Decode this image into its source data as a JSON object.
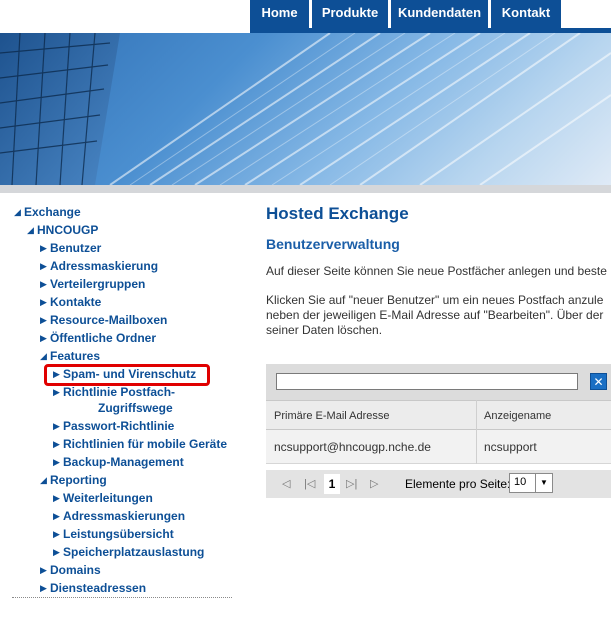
{
  "nav": {
    "items": [
      {
        "label": "Home"
      },
      {
        "label": "Produkte"
      },
      {
        "label": "Kundendaten"
      },
      {
        "label": "Kontakt"
      }
    ]
  },
  "tree": {
    "exchange": "Exchange",
    "hncougp": "HNCOUGP",
    "benutzer": "Benutzer",
    "adressmaskierung": "Adressmaskierung",
    "verteilergruppen": "Verteilergruppen",
    "kontakte": "Kontakte",
    "resource_mailboxen": "Resource-Mailboxen",
    "oeffentliche_ordner": "Öffentliche Ordner",
    "features": "Features",
    "spam": "Spam- und Virenschutz",
    "richtlinie_postfach_1": "Richtlinie Postfach-",
    "richtlinie_postfach_2": "Zugriffswege",
    "passwort": "Passwort-Richtlinie",
    "mobile": "Richtlinien für mobile Geräte",
    "backup": "Backup-Management",
    "reporting": "Reporting",
    "weiterleitungen": "Weiterleitungen",
    "adressmaskierungen": "Adressmaskierungen",
    "leistungsuebersicht": "Leistungsübersicht",
    "speicherplatz": "Speicherplatzauslastung",
    "domains": "Domains",
    "diensteadressen": "Diensteadressen"
  },
  "content": {
    "title": "Hosted Exchange",
    "subtitle": "Benutzerverwaltung",
    "para1": "Auf dieser Seite können Sie neue Postfächer anlegen und beste",
    "para2_l1": "Klicken Sie auf \"neuer Benutzer\" um ein neues Postfach anzule",
    "para2_l2": "neben der jeweiligen E-Mail Adresse auf \"Bearbeiten\". Über der",
    "para2_l3": "seiner Daten löschen."
  },
  "grid": {
    "search_value": "",
    "clear_icon": "✕",
    "columns": [
      "Primäre E-Mail Adresse",
      "Anzeigename"
    ],
    "rows": [
      [
        "ncsupport@hncougp.nche.de",
        "ncsupport"
      ]
    ],
    "pager": {
      "current_page": "1",
      "page_size_label": "Elemente pro Seite:",
      "page_size": "10"
    }
  },
  "colors": {
    "brand": "#0d4f96",
    "highlight": "#e00000"
  }
}
